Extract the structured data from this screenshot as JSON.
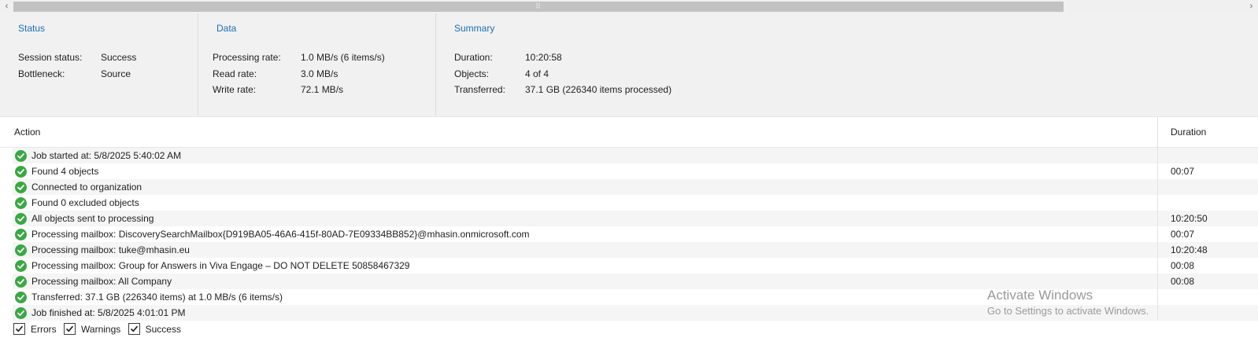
{
  "scrollbar": {
    "left_arrow": "‹",
    "right_arrow": "›",
    "grip": "⠿"
  },
  "status": {
    "heading": "Status",
    "session_status_label": "Session status:",
    "session_status_value": "Success",
    "bottleneck_label": "Bottleneck:",
    "bottleneck_value": "Source"
  },
  "data": {
    "heading": "Data",
    "processing_rate_label": "Processing rate:",
    "processing_rate_value": "1.0 MB/s (6 items/s)",
    "read_rate_label": "Read rate:",
    "read_rate_value": "3.0 MB/s",
    "write_rate_label": "Write rate:",
    "write_rate_value": "72.1 MB/s"
  },
  "summary": {
    "heading": "Summary",
    "duration_label": "Duration:",
    "duration_value": "10:20:58",
    "objects_label": "Objects:",
    "objects_value": "4 of 4",
    "transferred_label": "Transferred:",
    "transferred_value": "37.1 GB (226340 items processed)"
  },
  "table": {
    "col_action": "Action",
    "col_duration": "Duration",
    "rows": [
      {
        "action": "Job started at: 5/8/2025 5:40:02 AM",
        "duration": ""
      },
      {
        "action": "Found 4 objects",
        "duration": "00:07"
      },
      {
        "action": "Connected to organization",
        "duration": ""
      },
      {
        "action": "Found 0 excluded objects",
        "duration": ""
      },
      {
        "action": "All objects sent to processing",
        "duration": "10:20:50"
      },
      {
        "action": "Processing mailbox: DiscoverySearchMailbox{D919BA05-46A6-415f-80AD-7E09334BB852}@mhasin.onmicrosoft.com",
        "duration": "00:07"
      },
      {
        "action": "Processing mailbox: tuke@mhasin.eu",
        "duration": "10:20:48"
      },
      {
        "action": "Processing mailbox: Group for Answers in Viva Engage – DO NOT DELETE 50858467329",
        "duration": "00:08"
      },
      {
        "action": "Processing mailbox: All Company",
        "duration": "00:08"
      },
      {
        "action": "Transferred: 37.1 GB (226340 items) at 1.0 MB/s (6 items/s)",
        "duration": ""
      },
      {
        "action": "Job finished at: 5/8/2025 4:01:01 PM",
        "duration": ""
      }
    ]
  },
  "filters": {
    "errors": "Errors",
    "warnings": "Warnings",
    "success": "Success"
  },
  "watermark": {
    "line1": "Activate Windows",
    "line2": "Go to Settings to activate Windows."
  },
  "colors": {
    "accent": "#1a6fb4",
    "success": "#3aa843",
    "panel_bg": "#f1f1f1"
  }
}
